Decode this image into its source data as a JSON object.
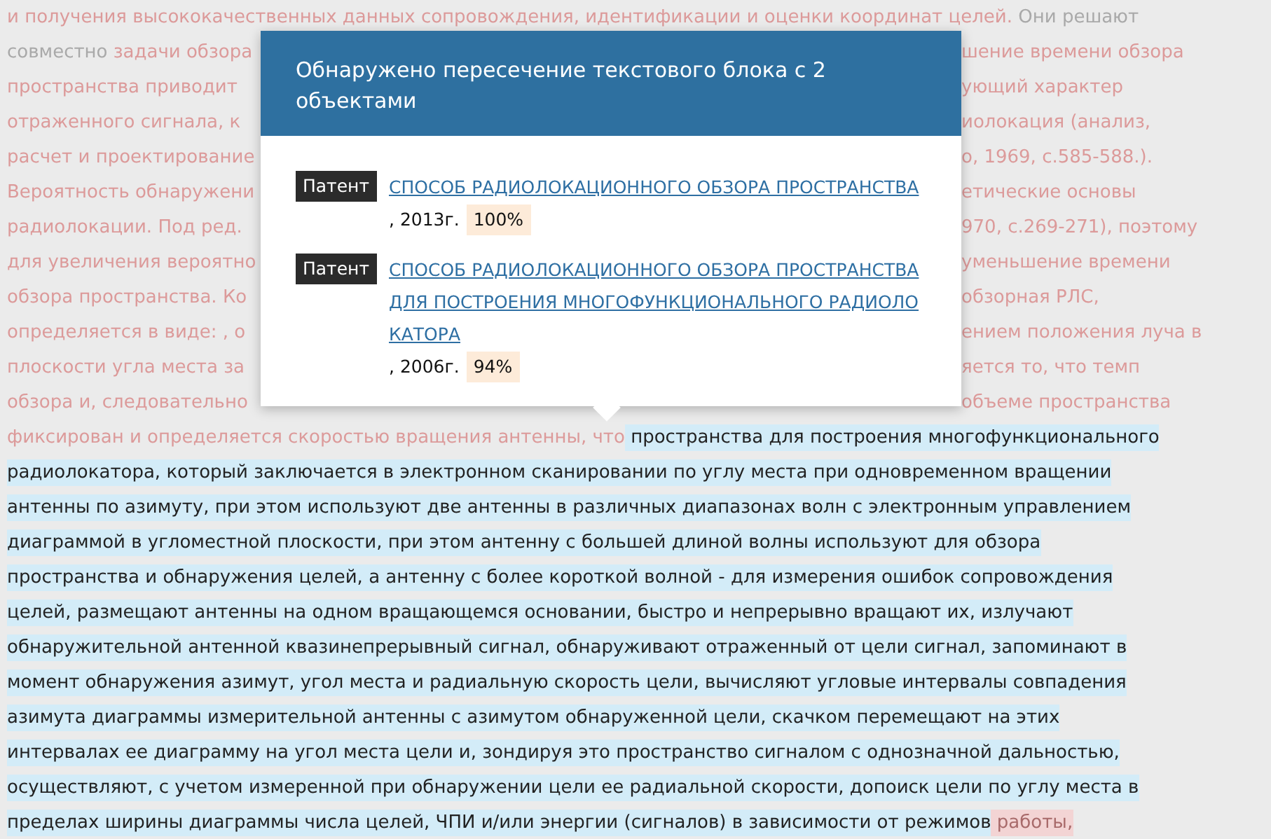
{
  "document": {
    "lines": [
      {
        "left": [
          {
            "kind": "match",
            "text": "и получения высококачественных данных сопровождения, идентификации и оценки координат целей."
          },
          {
            "kind": "plain",
            "text": " Они решают"
          }
        ]
      },
      {
        "left": [
          {
            "kind": "plain",
            "text": "совместно"
          },
          {
            "kind": "match",
            "text": " задачи обзора"
          }
        ],
        "right": [
          {
            "kind": "match",
            "text": "шение времени обзора"
          }
        ]
      },
      {
        "left": [
          {
            "kind": "match",
            "text": "пространства приводит"
          }
        ],
        "right": [
          {
            "kind": "match",
            "text": "ующий характер"
          }
        ]
      },
      {
        "left": [
          {
            "kind": "match",
            "text": "отраженного сигнала, к"
          }
        ],
        "right": [
          {
            "kind": "match",
            "text": "иолокация (анализ,"
          }
        ]
      },
      {
        "left": [
          {
            "kind": "match",
            "text": "расчет и проектирование"
          }
        ],
        "right": [
          {
            "kind": "match",
            "text": "о, 1969, с.585-588.)."
          }
        ]
      },
      {
        "left": [
          {
            "kind": "match",
            "text": "Вероятность обнаружени"
          }
        ],
        "right": [
          {
            "kind": "match",
            "text": "етические основы"
          }
        ]
      },
      {
        "left": [
          {
            "kind": "match",
            "text": "радиолокации. Под ред."
          }
        ],
        "right": [
          {
            "kind": "match",
            "text": "970, с.269-271), поэтому"
          }
        ]
      },
      {
        "left": [
          {
            "kind": "match",
            "text": "для увеличения вероятно"
          }
        ],
        "right": [
          {
            "kind": "match",
            "text": "уменьшение времени"
          }
        ]
      },
      {
        "left": [
          {
            "kind": "match",
            "text": "обзора пространства. Ко"
          }
        ],
        "right": [
          {
            "kind": "match",
            "text": "обзорная РЛС,"
          }
        ]
      },
      {
        "left": [
          {
            "kind": "match",
            "text": "определяется в виде: , о"
          }
        ],
        "right": [
          {
            "kind": "match",
            "text": "ением положения луча в"
          }
        ]
      },
      {
        "left": [
          {
            "kind": "match",
            "text": "плоскости угла места за"
          }
        ],
        "right": [
          {
            "kind": "match",
            "text": "яется то, что темп"
          }
        ]
      },
      {
        "left": [
          {
            "kind": "match",
            "text": "обзора и, следовательно"
          }
        ],
        "right": [
          {
            "kind": "match",
            "text": "объеме пространства"
          }
        ]
      },
      {
        "left": [
          {
            "kind": "match",
            "text": "фиксирован и определяется скоростью вращения антенны, что"
          },
          {
            "kind": "current",
            "text": " пространства для построения многофункционального"
          }
        ]
      },
      {
        "left": [
          {
            "kind": "current",
            "text": "радиолокатора, который заключается в электронном сканировании по углу места при одновременном вращении"
          }
        ]
      },
      {
        "left": [
          {
            "kind": "current",
            "text": "антенны по азимуту, при этом используют две антенны в различных диапазонах волн с электронным управлением"
          }
        ]
      },
      {
        "left": [
          {
            "kind": "current",
            "text": "диаграммой в угломестной плоскости, при этом антенну с большей длиной волны используют для обзора"
          }
        ]
      },
      {
        "left": [
          {
            "kind": "current",
            "text": "пространства и обнаружения целей, а антенну с более короткой волной - для измерения ошибок сопровождения"
          }
        ]
      },
      {
        "left": [
          {
            "kind": "current",
            "text": "целей, размещают антенны на одном вращающемся основании, быстро и непрерывно вращают их, излучают"
          }
        ]
      },
      {
        "left": [
          {
            "kind": "current",
            "text": "обнаружительной антенной квазинепрерывный сигнал, обнаруживают отраженный от цели сигнал, запоминают в"
          }
        ]
      },
      {
        "left": [
          {
            "kind": "current",
            "text": "момент обнаружения азимут, угол места и радиальную скорость цели, вычисляют угловые интервалы совпадения"
          }
        ]
      },
      {
        "left": [
          {
            "kind": "current",
            "text": "азимута диаграммы измерительной антенны с азимутом обнаруженной цели, скачком перемещают на этих"
          }
        ]
      },
      {
        "left": [
          {
            "kind": "current",
            "text": "интервалах ее диаграмму на угол места цели и, зондируя это пространство сигналом с однозначной дальностью,"
          }
        ]
      },
      {
        "left": [
          {
            "kind": "current",
            "text": "осуществляют, с учетом измеренной при обнаружении цели ее радиальной скорости, допоиск цели по углу места в"
          }
        ]
      },
      {
        "left": [
          {
            "kind": "current",
            "text": "пределах ширины диаграммы числа целей, ЧПИ и/или энергии (сигналов) в зависимости от режимов"
          },
          {
            "kind": "match_marked",
            "text": " работы,"
          }
        ]
      }
    ]
  },
  "popup": {
    "title": "Обнаружено пересечение текстового блока с 2 объектами",
    "items": [
      {
        "tag": "Патент",
        "title": "СПОСОБ РАДИОЛОКАЦИОННОГО ОБЗОРА ПРОСТРАНСТВА",
        "year": ", 2013г.",
        "percent": "100%"
      },
      {
        "tag": "Патент",
        "title": "СПОСОБ РАДИОЛОКАЦИОННОГО ОБЗОРА ПРОСТРАНСТВА ДЛЯ ПОСТРОЕНИЯ МНОГОФУНКЦИОНАЛЬНОГО РАДИОЛОКАТОРА",
        "year": ", 2006г.",
        "percent": "94%"
      }
    ]
  }
}
